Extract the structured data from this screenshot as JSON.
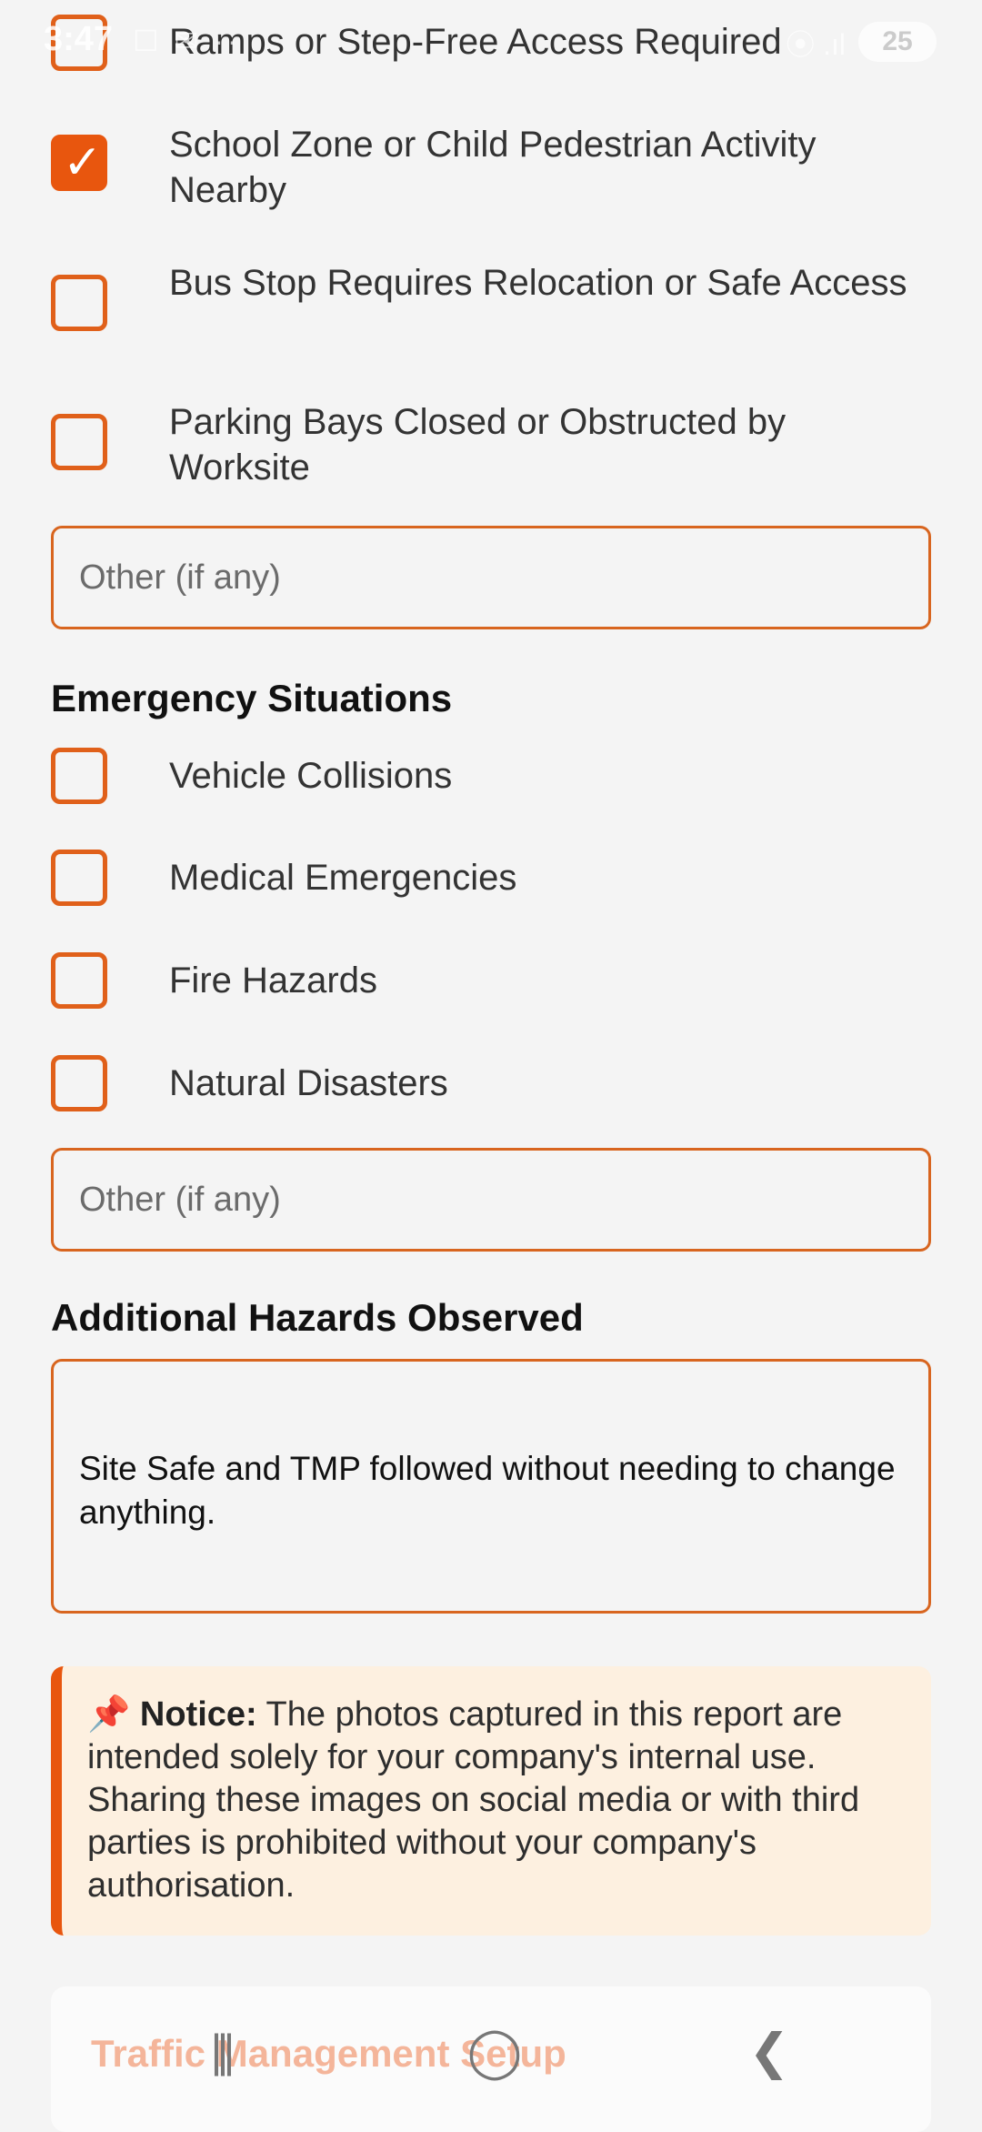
{
  "status_bar": {
    "time": "3:47",
    "left_icons": "☐ ✉ ··",
    "right_icons": "⦿ .ıl",
    "battery": "25"
  },
  "access_section": {
    "items": [
      {
        "label": "Ramps or Step-Free Access Required",
        "checked": false
      },
      {
        "label": "School Zone or Child Pedestrian Activity Nearby",
        "checked": true
      },
      {
        "label": "Bus Stop Requires Relocation or Safe Access",
        "checked": false
      },
      {
        "label": "Parking Bays Closed or Obstructed by Worksite",
        "checked": false
      }
    ],
    "other_placeholder": "Other (if any)"
  },
  "emergency_section": {
    "title": "Emergency Situations",
    "items": [
      {
        "label": "Vehicle Collisions",
        "checked": false
      },
      {
        "label": "Medical Emergencies",
        "checked": false
      },
      {
        "label": "Fire Hazards",
        "checked": false
      },
      {
        "label": "Natural Disasters",
        "checked": false
      }
    ],
    "other_placeholder": "Other (if any)"
  },
  "additional_hazards": {
    "title": "Additional Hazards Observed",
    "value": "Site Safe and TMP followed without needing to change anything."
  },
  "notice": {
    "icon": "📌",
    "heading": "Notice:",
    "text": " The photos captured in this report are intended solely for your company's internal use. Sharing these images on social media or with third parties is prohibited without your company's authorisation."
  },
  "next_section": {
    "title": "Traffic Management Setup"
  },
  "nav_bar": {
    "recents": "|||",
    "home": "◯",
    "back": "❮"
  },
  "colors": {
    "accent": "#e8560e",
    "border": "#d8651f",
    "notice_bg": "#fdf0e0",
    "background": "#f4f4f4"
  }
}
